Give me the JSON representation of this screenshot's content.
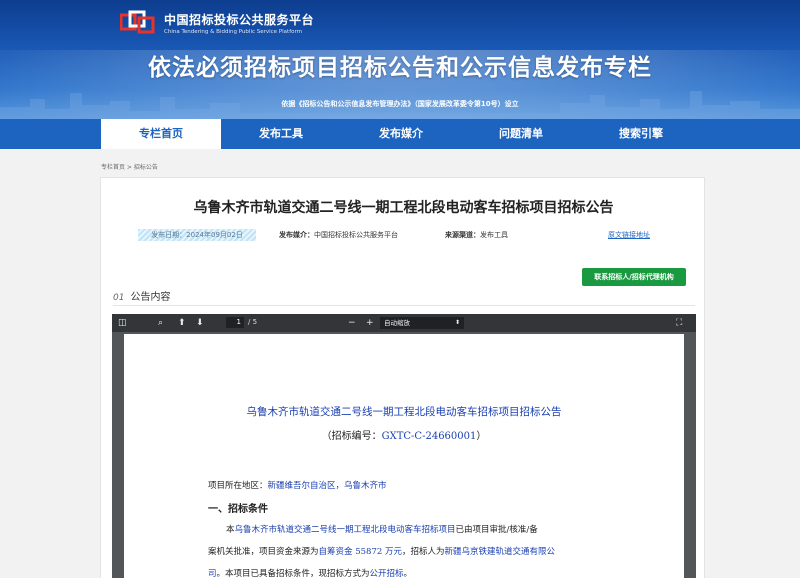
{
  "header": {
    "logo_cn": "中国招标投标公共服务平台",
    "logo_en": "China Tendering & Bidding Public Service Platform",
    "title": "依法必须招标项目招标公告和公示信息发布专栏",
    "subtitle": "依据《招标公告和公示信息发布管理办法》（国家发展改革委令第10号）设立"
  },
  "nav": {
    "items": [
      {
        "label": "专栏首页",
        "active": true
      },
      {
        "label": "发布工具"
      },
      {
        "label": "发布媒介"
      },
      {
        "label": "问题清单"
      },
      {
        "label": "搜索引擎"
      }
    ]
  },
  "breadcrumb": "专栏首页 > 招标公告",
  "article": {
    "title": "乌鲁木齐市轨道交通二号线一期工程北段电动客车招标项目招标公告",
    "date": "发布日期：2024年09月02日",
    "media_label": "发布媒介：",
    "media_value": "中国招标投标公共服务平台",
    "source_label": "来源渠道：",
    "source_value": "发布工具",
    "original_link": "原文链接地址",
    "contact_button": "联系招标人/招标代理机构",
    "section_num": "01",
    "section_label": "公告内容"
  },
  "pdf": {
    "page_current": "1",
    "page_total": "/ 5",
    "zoom": "自动缩放",
    "doc_title": "乌鲁木齐市轨道交通二号线一期工程北段电动客车招标项目招标公告",
    "code_prefix": "（招标编号：",
    "code_value": "GXTC-C-24660001",
    "code_suffix": "）",
    "location_label": "项目所在地区：",
    "location_value": "新疆维吾尔自治区，乌鲁木齐市",
    "heading1": "一、招标条件",
    "para_l1_a": "本",
    "para_l1_b": "乌鲁木齐市轨道交通二号线一期工程北段电动客车招标项目",
    "para_l1_c": "已由项目审批/核准/备",
    "para_l2_a": "案机关批准，项目资金来源为",
    "para_l2_b": "自筹资金 55872 万元",
    "para_l2_c": "，招标人为",
    "para_l2_d": "新疆乌京铁建轨道交通有限公",
    "para_l3_a": "司",
    "para_l3_b": "。本项目已具备招标条件，现招标方式为",
    "para_l3_c": "公开招标",
    "para_l3_d": "。"
  }
}
